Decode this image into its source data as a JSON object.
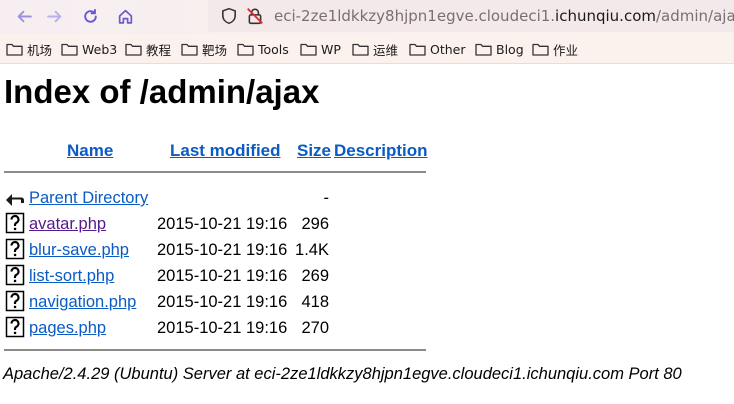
{
  "browser": {
    "url_prefix": "eci-2ze1ldkkzy8hjpn1egve.cloudeci1.",
    "url_domain": "ichunqiu.com",
    "url_path": "/admin/ajax/"
  },
  "bookmarks": [
    {
      "label": "机场"
    },
    {
      "label": "Web3"
    },
    {
      "label": "教程"
    },
    {
      "label": "靶场"
    },
    {
      "label": "Tools"
    },
    {
      "label": "WP"
    },
    {
      "label": "运维"
    },
    {
      "label": "Other"
    },
    {
      "label": "Blog"
    },
    {
      "label": "作业"
    }
  ],
  "page": {
    "title": "Index of /admin/ajax",
    "columns": {
      "name": "Name",
      "last_modified": "Last modified",
      "size": "Size",
      "description": "Description"
    },
    "parent": {
      "name": "Parent Directory",
      "size": "-"
    },
    "files": [
      {
        "name": "avatar.php",
        "modified": "2015-10-21 19:16",
        "size": "296",
        "visited": true
      },
      {
        "name": "blur-save.php",
        "modified": "2015-10-21 19:16",
        "size": "1.4K",
        "visited": false
      },
      {
        "name": "list-sort.php",
        "modified": "2015-10-21 19:16",
        "size": "269",
        "visited": false
      },
      {
        "name": "navigation.php",
        "modified": "2015-10-21 19:16",
        "size": "418",
        "visited": false
      },
      {
        "name": "pages.php",
        "modified": "2015-10-21 19:16",
        "size": "270",
        "visited": false
      }
    ],
    "footer": "Apache/2.4.29 (Ubuntu) Server at eci-2ze1ldkkzy8hjpn1egve.cloudeci1.ichunqiu.com Port 80"
  },
  "colors": {
    "link": "#0a5bc4",
    "visited_link": "#551a8b",
    "toolbar_bg": "#f6eef0"
  },
  "icons": {
    "back": "arrow-left-icon",
    "forward": "arrow-right-icon",
    "reload": "reload-icon",
    "home": "home-icon",
    "shield": "shield-icon",
    "insecure": "insecure-lock-icon",
    "folder": "folder-icon",
    "parent": "back-arrow-icon",
    "file": "unknown-file-icon"
  }
}
